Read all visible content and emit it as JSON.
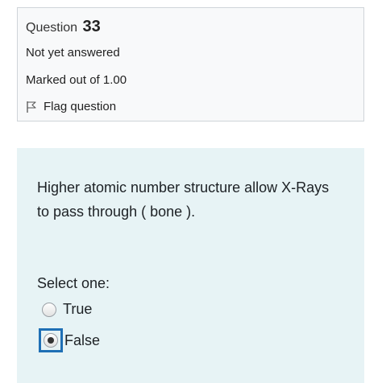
{
  "question_info": {
    "label": "Question",
    "number": "33",
    "state": "Not yet answered",
    "grade": "Marked out of 1.00",
    "flag_label": "Flag question"
  },
  "formulation": {
    "question_text": "Higher atomic number structure allow X-Rays to pass through ( bone ).",
    "prompt": "Select one:",
    "options": [
      {
        "label": "True",
        "selected": false
      },
      {
        "label": "False",
        "selected": true
      }
    ]
  },
  "colors": {
    "info_background": "#f8f9fa",
    "formulation_background": "#e7f3f5",
    "focus_outline": "#1f6fb5"
  }
}
